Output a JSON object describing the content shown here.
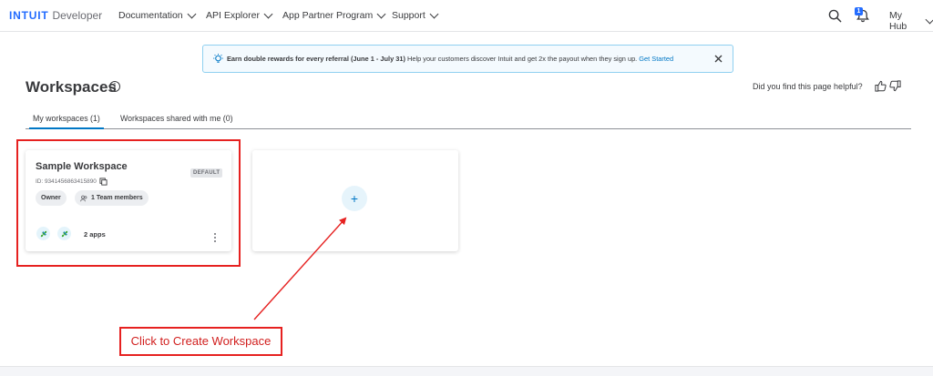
{
  "nav": {
    "brand_mark": "INTUIT",
    "brand_product": "Developer",
    "items": [
      {
        "label": "Documentation"
      },
      {
        "label": "API Explorer"
      },
      {
        "label": "App Partner Program"
      },
      {
        "label": "Support"
      }
    ],
    "notification_count": "1",
    "hub_label": "My Hub"
  },
  "banner": {
    "bold_text": "Earn double rewards for every referral (June 1 - July 31)",
    "body_text": " Help your customers discover Intuit and get 2x the payout when they sign up. ",
    "link_text": "Get Started"
  },
  "page": {
    "title": "Workspaces",
    "info_glyph": "i",
    "helpful_prompt": "Did you find this page helpful?"
  },
  "tabs": [
    {
      "label": "My workspaces (1)",
      "active": true
    },
    {
      "label": "Workspaces shared with me (0)",
      "active": false
    }
  ],
  "workspace": {
    "name": "Sample Workspace",
    "default_badge": "DEFAULT",
    "id_text": "ID: 9341456863415890",
    "role": "Owner",
    "members": "1 Team members",
    "apps": "2 apps"
  },
  "new_workspace": {
    "plus": "+"
  },
  "annotation": {
    "callout_text": "Click to Create Workspace",
    "color": "#e62120"
  },
  "colors": {
    "brand": "#236cff",
    "link": "#0077c5",
    "text": "#393a3d"
  }
}
